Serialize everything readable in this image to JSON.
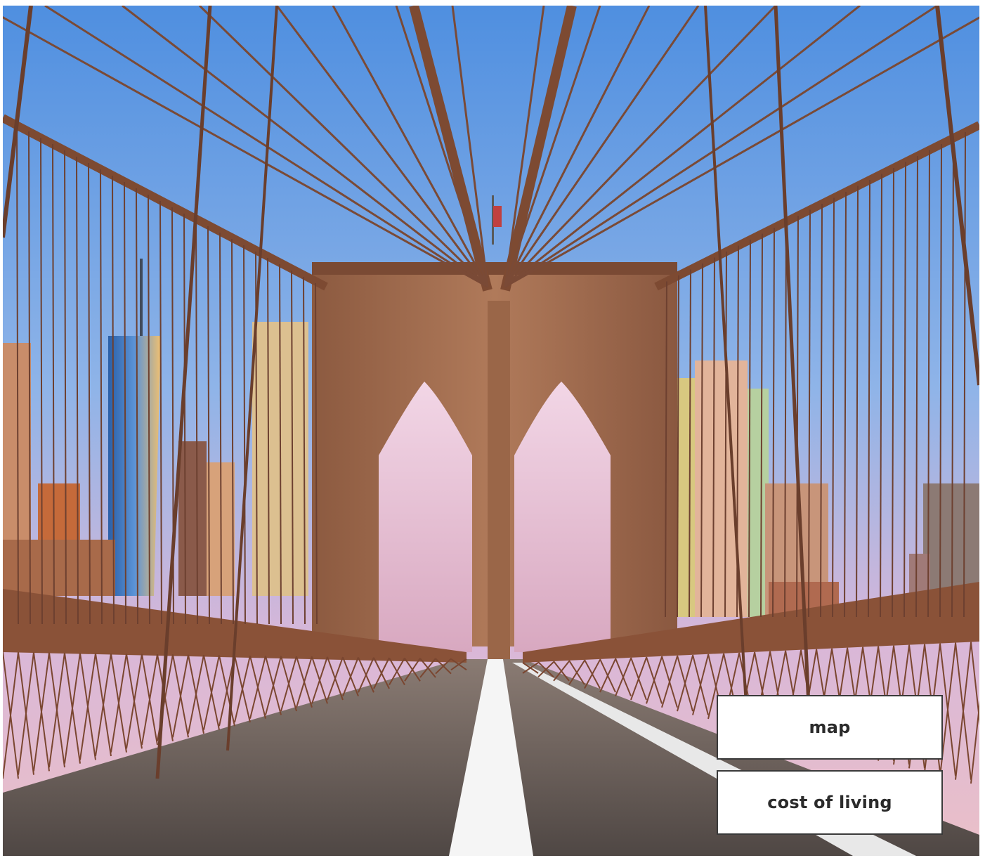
{
  "hero_image": {
    "subject": "suspension-bridge-walkway-illustration"
  },
  "actions": {
    "map_label": "map",
    "cost_label": "cost of living"
  },
  "colors": {
    "sky_top": "#4f8fe0",
    "sky_bottom": "#e6b8d4",
    "stone": "#a97456",
    "stone_dark": "#7d4f38",
    "deck": "#6b5e58",
    "railing": "#8a5238",
    "lane_line": "#f5f5f5",
    "button_bg": "#ffffff",
    "button_border": "#3a3a3a",
    "button_text": "#2b2b2b"
  }
}
